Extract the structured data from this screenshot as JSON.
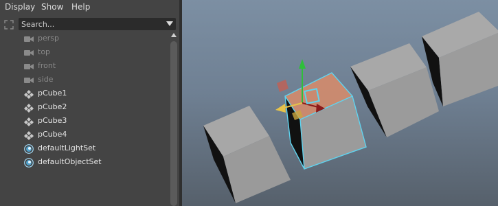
{
  "menubar": {
    "items": [
      "Display",
      "Show",
      "Help"
    ]
  },
  "search": {
    "placeholder": "Search..."
  },
  "outliner": {
    "items": [
      {
        "label": "persp",
        "icon": "camera-icon",
        "dimmed": true
      },
      {
        "label": "top",
        "icon": "camera-icon",
        "dimmed": true
      },
      {
        "label": "front",
        "icon": "camera-icon",
        "dimmed": true
      },
      {
        "label": "side",
        "icon": "camera-icon",
        "dimmed": true
      },
      {
        "label": "pCube1",
        "icon": "mesh-transform-icon",
        "dimmed": false
      },
      {
        "label": "pCube2",
        "icon": "mesh-transform-icon",
        "dimmed": false
      },
      {
        "label": "pCube3",
        "icon": "mesh-transform-icon",
        "dimmed": false
      },
      {
        "label": "pCube4",
        "icon": "mesh-transform-icon",
        "dimmed": false
      },
      {
        "label": "defaultLightSet",
        "icon": "set-icon",
        "dimmed": false
      },
      {
        "label": "defaultObjectSet",
        "icon": "set-icon",
        "dimmed": false
      }
    ]
  },
  "colors": {
    "panel_bg": "#444444",
    "dim_text": "#8a8a8a",
    "bright_text": "#e6e6e6",
    "selection_outline": "#5fd4f0",
    "manipulator_x": "#8b1a1a",
    "manipulator_y": "#2fbf3a",
    "manipulator_z": "#e6c34a",
    "selected_face": "#d98c6a"
  }
}
